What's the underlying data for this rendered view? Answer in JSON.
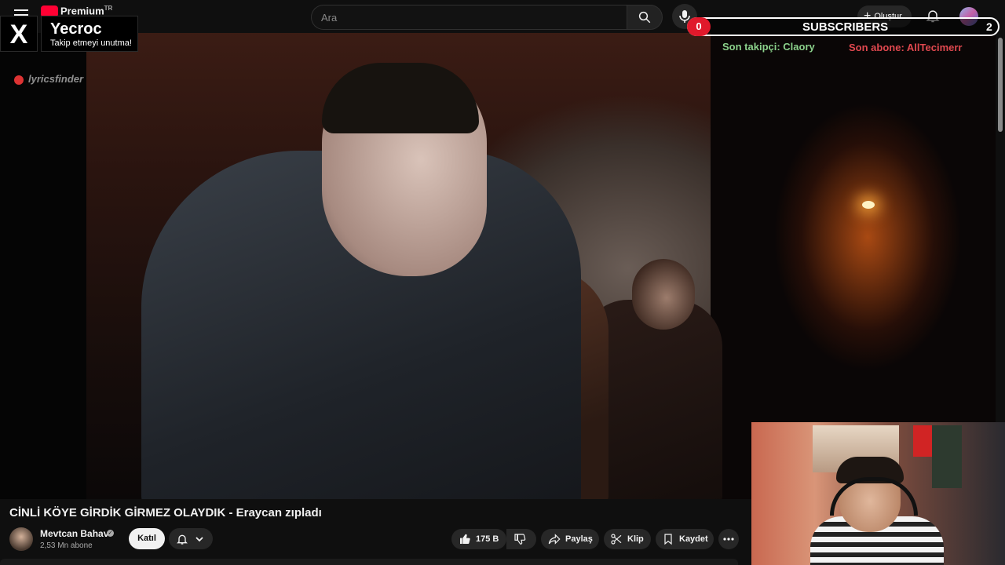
{
  "topbar": {
    "logo_text": "Premium",
    "logo_region": "TR",
    "search_placeholder": "Ara",
    "create_label": "Oluştur"
  },
  "overlay": {
    "x_name": "Yecroc",
    "x_subtitle": "Takip etmeyi unutma!",
    "subscribers_label": "SUBSCRIBERS",
    "subscribers_current": "0",
    "subscribers_goal": "2",
    "last_follower": "Son takipçi: Claory",
    "last_subscriber": "Son abone: AllTecimerr"
  },
  "video": {
    "title": "CİNLİ KÖYE GİRDİK GİRMEZ OLAYDIK - Eraycan zıpladı",
    "watermark": "lyricsfinder"
  },
  "channel": {
    "name": "Mevtcan Bahav",
    "subscribers": "2,53 Mn abone",
    "join_label": "Katıl"
  },
  "actions": {
    "likes": "175 B",
    "share_label": "Paylaş",
    "clip_label": "Klip",
    "save_label": "Kaydet"
  }
}
